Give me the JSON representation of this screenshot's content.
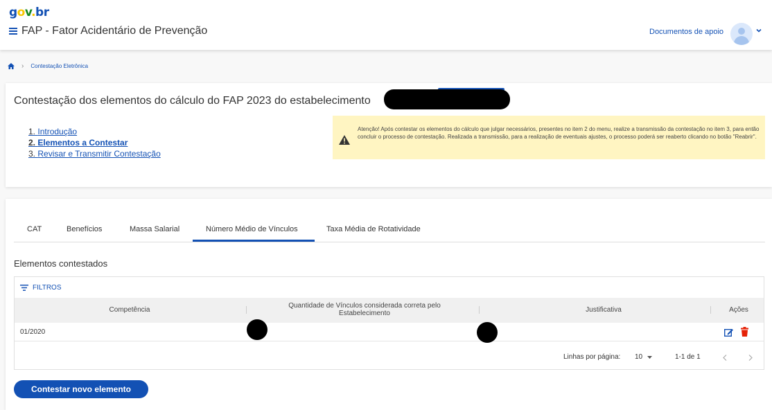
{
  "header": {
    "logo": {
      "g": "g",
      "o": "o",
      "v": "v",
      "dot": ".",
      "b": "b",
      "r": "r"
    },
    "app_title": "FAP - Fator Acidentário de Prevenção",
    "docs_link": "Documentos de apoio"
  },
  "breadcrumb": {
    "current": "Contestação Eletrônica"
  },
  "card": {
    "title": "Contestação dos elementos do cálculo do FAP 2023 do estabelecimento",
    "steps": [
      {
        "num": "1.",
        "label": "Introdução"
      },
      {
        "num": "2.",
        "label": "Elementos a Contestar"
      },
      {
        "num": "3.",
        "label": "Revisar e Transmitir Contestação"
      }
    ],
    "warning": "Atenção! Após contestar os elementos do cálculo que julgar necessários, presentes no item 2 do menu, realize a transmissão da contestação no item 3, para então concluir o processo de contestação. Realizada a transmissão, para a realização de eventuais ajustes, o processo poderá ser reaberto clicando no botão \"Reabrir\"."
  },
  "tabs": [
    {
      "label": "CAT"
    },
    {
      "label": "Benefícios"
    },
    {
      "label": "Massa Salarial"
    },
    {
      "label": "Número Médio de Vínculos"
    },
    {
      "label": "Taxa Média de Rotatividade"
    }
  ],
  "section_title": "Elementos contestados",
  "filters_label": "FILTROS",
  "table": {
    "columns": [
      "Competência",
      "Quantidade de Vínculos considerada correta pelo Estabelecimento",
      "Justificativa",
      "Ações"
    ],
    "rows": [
      {
        "competencia": "01/2020"
      }
    ]
  },
  "pager": {
    "rows_label": "Linhas por página:",
    "rows_value": "10",
    "range": "1-1 de 1"
  },
  "primary_button": "Contestar novo elemento",
  "colors": {
    "primary": "#1351b4",
    "warning_bg": "#fff5c2",
    "danger": "#e52207"
  }
}
